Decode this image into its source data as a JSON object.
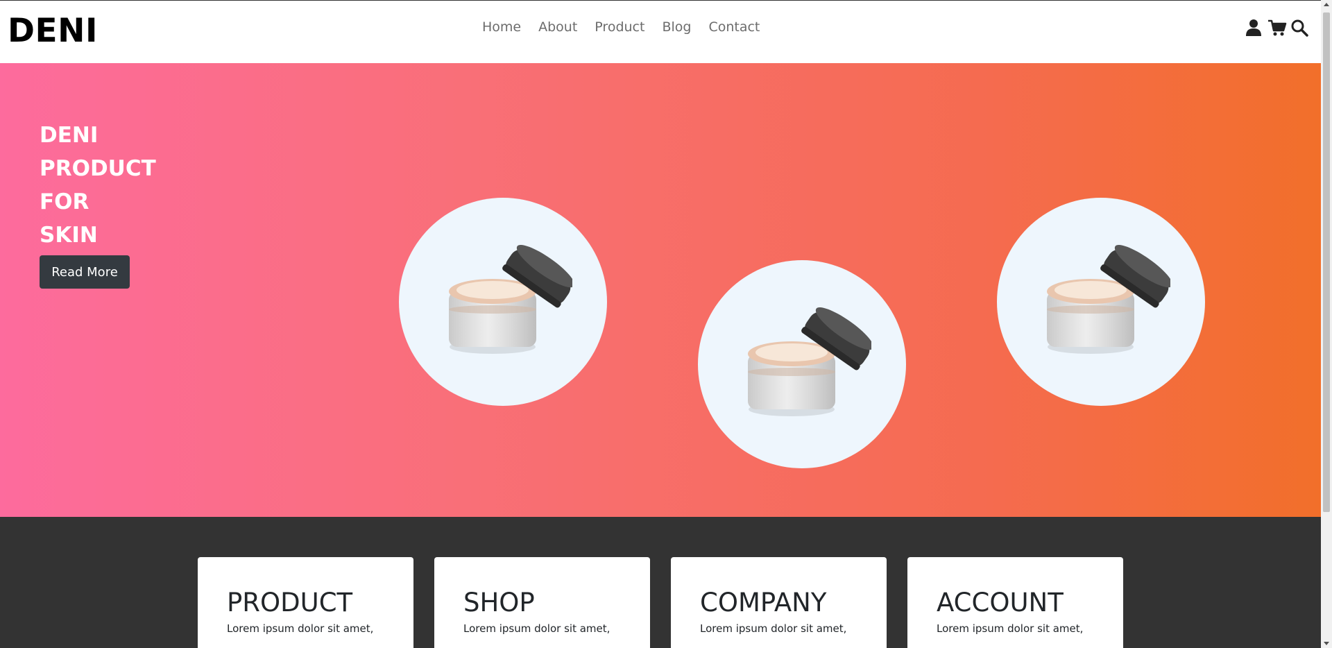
{
  "brand": {
    "logo": "DENI"
  },
  "nav": [
    {
      "label": "Home"
    },
    {
      "label": "About"
    },
    {
      "label": "Product"
    },
    {
      "label": "Blog"
    },
    {
      "label": "Contact"
    }
  ],
  "header_icons": [
    "user-icon",
    "cart-icon",
    "search-icon"
  ],
  "hero": {
    "title_lines": [
      "DENI",
      "PRODUCT",
      "FOR",
      "SKIN"
    ],
    "button_label": "Read More",
    "gradient": [
      "#fd6b9d",
      "#f26f2a"
    ],
    "product_images": [
      "cream-jar-image",
      "cream-jar-image",
      "cream-jar-image"
    ]
  },
  "cards": [
    {
      "title": "PRODUCT",
      "text": "Lorem ipsum dolor sit amet,"
    },
    {
      "title": "SHOP",
      "text": "Lorem ipsum dolor sit amet,"
    },
    {
      "title": "COMPANY",
      "text": "Lorem ipsum dolor sit amet,"
    },
    {
      "title": "ACCOUNT",
      "text": "Lorem ipsum dolor sit amet,"
    }
  ],
  "colors": {
    "dark_section": "#333333",
    "button": "#343a40",
    "circle": "#eef6fd"
  }
}
